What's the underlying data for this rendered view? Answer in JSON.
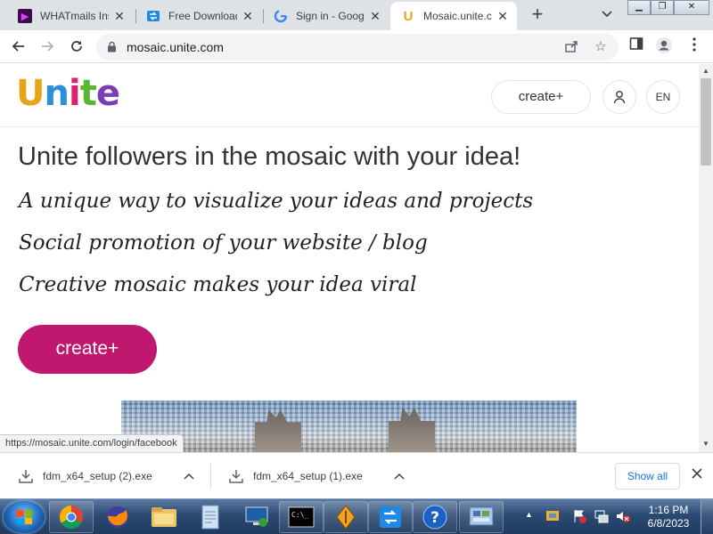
{
  "browser": {
    "tabs": [
      {
        "title": "WHATmails Insta",
        "favicon": "whatmails-icon"
      },
      {
        "title": "Free Download M",
        "favicon": "fdm-icon"
      },
      {
        "title": "Sign in - Google",
        "favicon": "google-icon"
      },
      {
        "title": "Mosaic.unite.com",
        "favicon": "unite-icon",
        "active": true
      }
    ],
    "new_tab": "+",
    "close_glyph": "✕",
    "url": "mosaic.unite.com"
  },
  "site": {
    "logo_letters": [
      "U",
      "n",
      "i",
      "t",
      "e"
    ],
    "logo_colors": [
      "#e8a317",
      "#2b8fd9",
      "#d6246e",
      "#5bb531",
      "#7b3fb5"
    ],
    "header_create": "create+",
    "lang": "EN",
    "headline": "Unite followers in the mosaic with your idea!",
    "taglines": [
      "A unique way to visualize your ideas and projects",
      "Social promotion of your website / blog",
      "Creative mosaic makes your idea viral"
    ],
    "cta": "create+",
    "accent": "#c0186e"
  },
  "status_url": "https://mosaic.unite.com/login/facebook",
  "downloads": {
    "items": [
      {
        "name": "fdm_x64_setup (2).exe"
      },
      {
        "name": "fdm_x64_setup (1).exe"
      }
    ],
    "show_all": "Show all"
  },
  "taskbar": {
    "apps": [
      "chrome-icon",
      "firefox-icon",
      "explorer-icon",
      "notepad-icon",
      "remote-desktop-icon",
      "cmd-icon",
      "installer-icon",
      "fdm-taskbar-icon",
      "help-icon",
      "control-panel-icon"
    ],
    "time": "1:16 PM",
    "date": "6/8/2023"
  }
}
